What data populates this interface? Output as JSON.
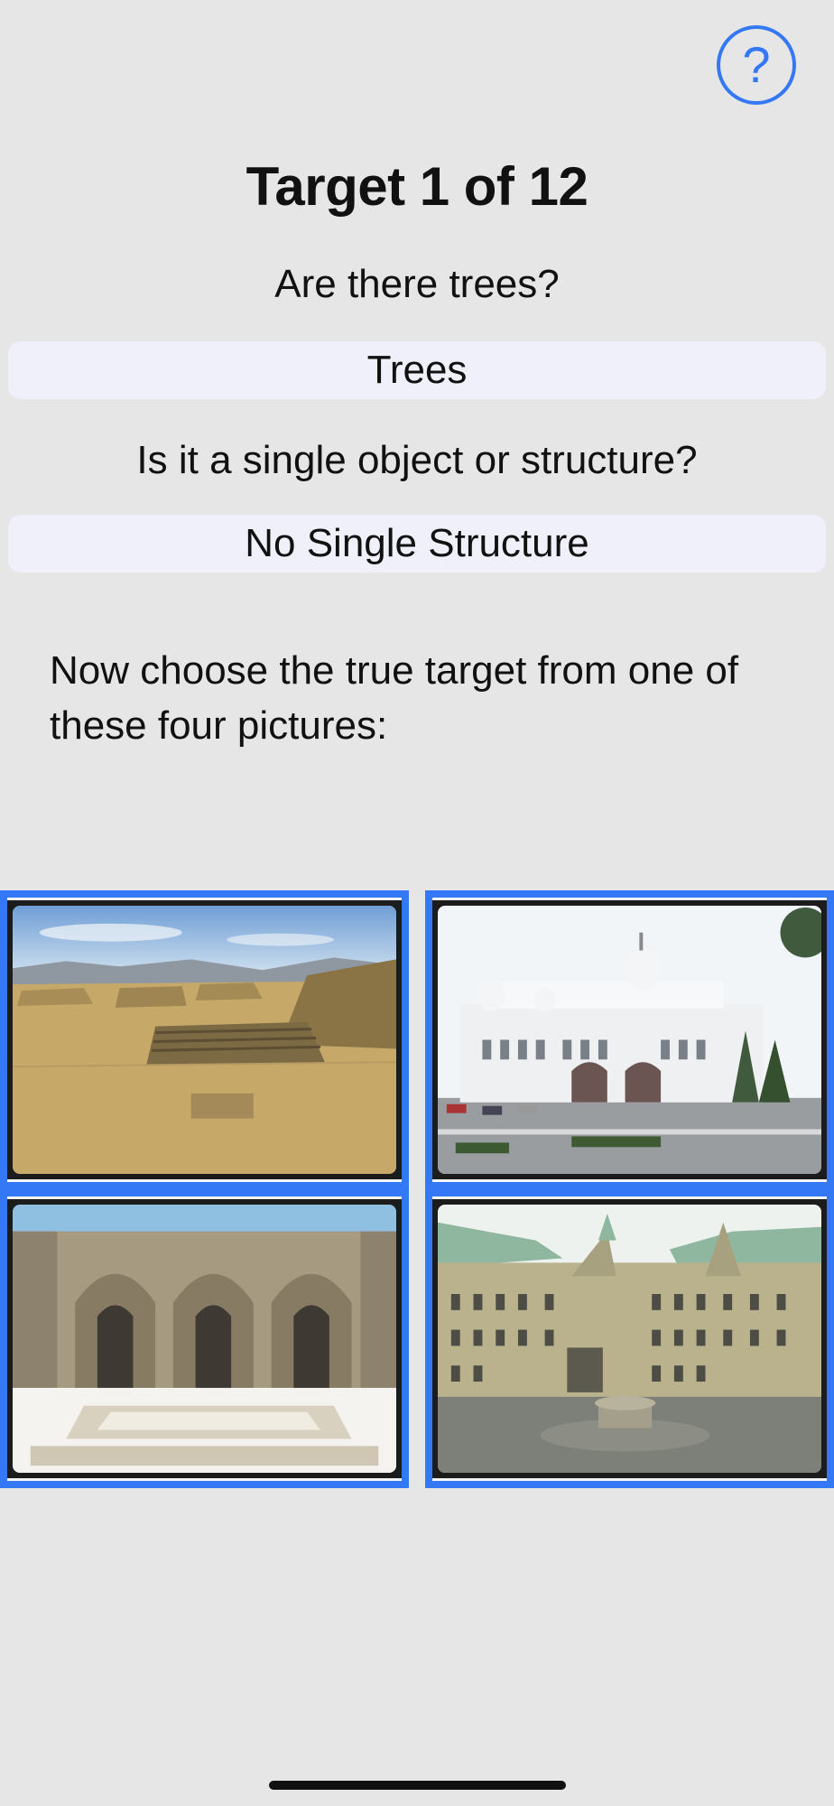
{
  "help": {
    "label": "?",
    "icon": "help-icon"
  },
  "header": {
    "title": "Target 1 of 12"
  },
  "questions": [
    {
      "question": "Are there trees?",
      "answer": "Trees"
    },
    {
      "question": "Is it a single object or structure?",
      "answer": "No Single Structure"
    }
  ],
  "instructions": "Now choose the true target from one of these four pictures:",
  "pictures": [
    {
      "subject": "ancient ruins plaza"
    },
    {
      "subject": "white domed building"
    },
    {
      "subject": "arched stone courtyard"
    },
    {
      "subject": "castle courtyard with fountain"
    }
  ],
  "colors": {
    "accent": "#3478f6",
    "background": "#e6e6e6",
    "answer_fill": "#f0f0fb"
  }
}
